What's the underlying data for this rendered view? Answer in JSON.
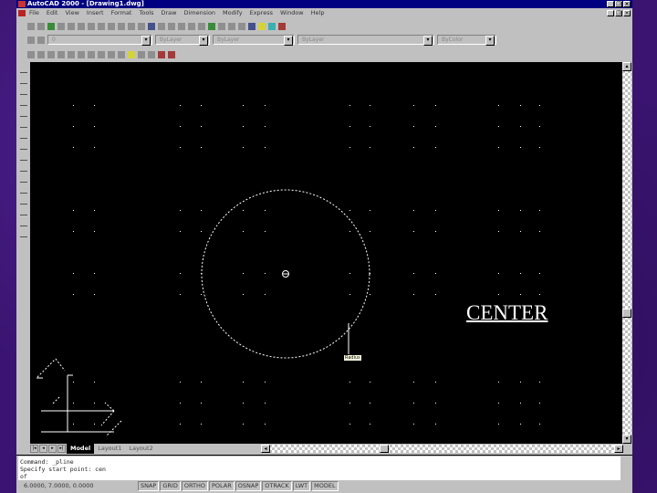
{
  "window": {
    "title": "AutoCAD 2000 - [Drawing1.dwg]",
    "buttons": [
      "_",
      "❐",
      "×"
    ]
  },
  "menu": [
    "File",
    "Edit",
    "View",
    "Insert",
    "Format",
    "Tools",
    "Draw",
    "Dimension",
    "Modify",
    "Express",
    "Window",
    "Help"
  ],
  "properties": {
    "layer": "0",
    "color": "ByLayer",
    "linetype": "ByLayer",
    "lineweight": "ByLayer",
    "plotstyle": "ByColor"
  },
  "drawing": {
    "annotation": "CENTER",
    "tooltip": "Radius"
  },
  "tabs": [
    "Model",
    "Layout1",
    "Layout2"
  ],
  "command": {
    "lines": [
      "Command: _pline",
      "Specify start point: cen",
      "of"
    ]
  },
  "status": {
    "coords": "6.0000, 7.0000, 0.0000",
    "toggles": [
      "SNAP",
      "GRID",
      "ORTHO",
      "POLAR",
      "OSNAP",
      "OTRACK",
      "LWT",
      "MODEL"
    ]
  }
}
